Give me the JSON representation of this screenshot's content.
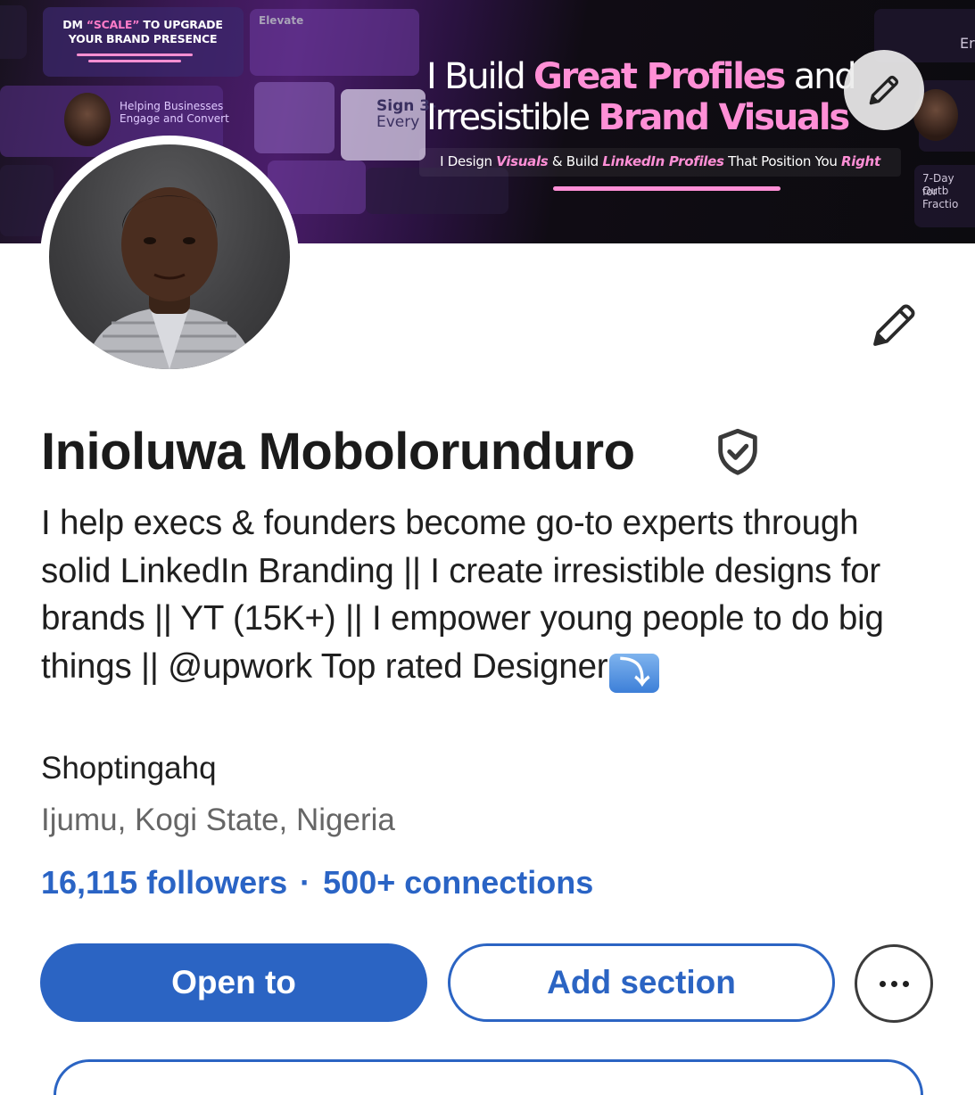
{
  "cover": {
    "dm_text_1": "DM ",
    "dm_keyword": "“SCALE”",
    "dm_text_2": " TO UPGRADE",
    "dm_text_3": "YOUR BRAND PRESENCE",
    "headline_line1_plain": "I Build ",
    "headline_line1_pink": "Great Profiles",
    "headline_line1_tail": " and",
    "headline_line2_plain": "Irresistible ",
    "headline_line2_pink": "Brand Visuals",
    "sub_1": "I Design ",
    "sub_2": "Visuals",
    "sub_3": " & Build ",
    "sub_4": "LinkedIn Profiles",
    "sub_5": " That Position You ",
    "sub_6": "Right",
    "side_left_1": "Helping Businesses",
    "side_left_2": "Engage and Convert",
    "side_mid": "Sign 3-",
    "side_mid_2": "Every",
    "side_right": "7-Day Outb",
    "side_right_2": "for Fractio",
    "side_top": "Elevate",
    "side_top_right": "Er"
  },
  "profile": {
    "name": "Inioluwa Mobolorunduro",
    "headline": "I help execs & founders become go-to experts through solid LinkedIn Branding || I create irresistible designs for brands || YT (15K+) || I empower young people to do big things || @upwork Top rated Designer",
    "headline_emoji": "⤵",
    "company": "Shoptingahq",
    "location": "Ijumu, Kogi State, Nigeria",
    "followers": "16,115 followers",
    "separator": "·",
    "connections": "500+ connections"
  },
  "actions": {
    "open_to": "Open to",
    "add_section": "Add section"
  },
  "icons": {
    "cover_edit": "pencil-icon",
    "intro_edit": "pencil-icon",
    "verified": "verified-shield-icon",
    "more": "more-horizontal-icon"
  },
  "colors": {
    "accent_blue": "#2b64c3",
    "banner_pink": "#ff8fd6"
  }
}
